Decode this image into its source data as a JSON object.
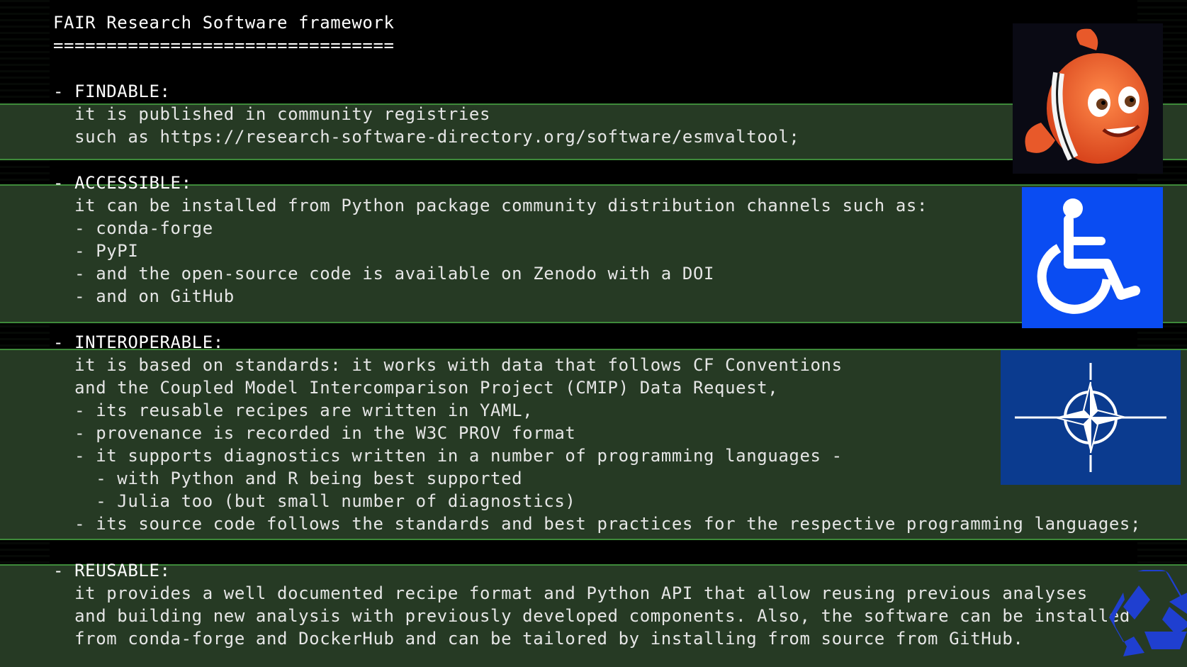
{
  "colors": {
    "background": "#000000",
    "band": "#263a24",
    "band_border": "#3e8a3a",
    "text": "#e6e6e6",
    "accessible_blue": "#0a4cf2",
    "nato_blue": "#0b3b8f",
    "recycle_blue": "#1f3fd0",
    "fish_orange": "#e8592a"
  },
  "icons": {
    "findable": "clownfish-cartoon-icon",
    "accessible": "wheelchair-accessibility-icon",
    "interoperable": "nato-compass-star-icon",
    "reusable": "recycle-icon"
  },
  "lines": [
    "FAIR Research Software framework",
    "================================",
    "- FINDABLE:",
    "  it is published in community registries",
    "  such as https://research-software-directory.org/software/esmvaltool;",
    "- ACCESSIBLE:",
    "  it can be installed from Python package community distribution channels such as:",
    "  - conda-forge",
    "  - PyPI",
    "  - and the open-source code is available on Zenodo with a DOI",
    "  - and on GitHub",
    "- INTEROPERABLE:",
    "  it is based on standards: it works with data that follows CF Conventions",
    "  and the Coupled Model Intercomparison Project (CMIP) Data Request,",
    "  - its reusable recipes are written in YAML,",
    "  - provenance is recorded in the W3C PROV format",
    "  - it supports diagnostics written in a number of programming languages -",
    "    - with Python and R being best supported",
    "    - Julia too (but small number of diagnostics)",
    "  - its source code follows the standards and best practices for the respective programming languages;",
    "- REUSABLE:",
    "  it provides a well documented recipe format and Python API that allow reusing previous analyses",
    "  and building new analysis with previously developed components. Also, the software can be installed",
    "  from conda-forge and DockerHub and can be tailored by installing from source from GitHub."
  ]
}
